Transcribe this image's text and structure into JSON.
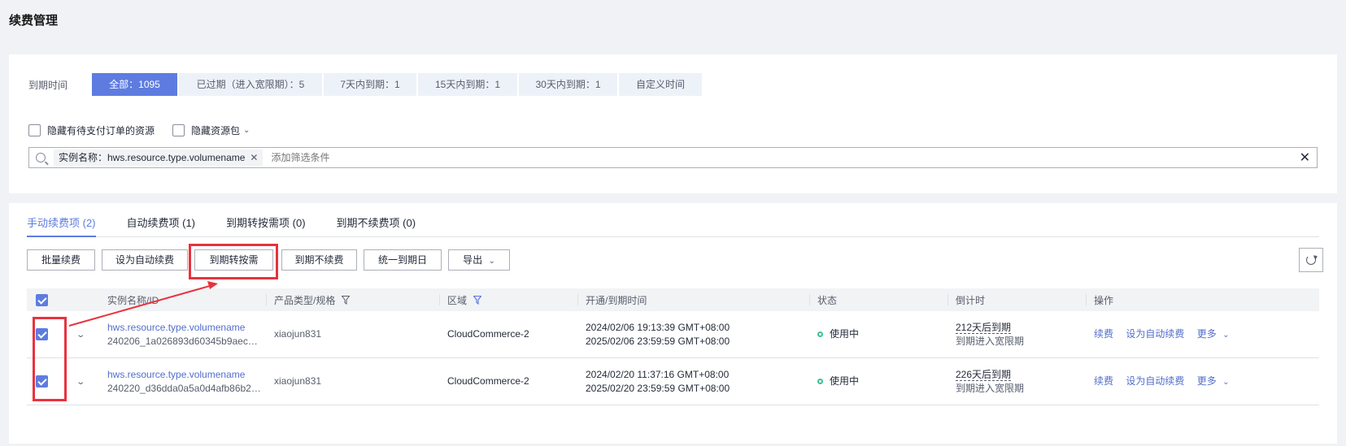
{
  "page_title": "续费管理",
  "filter": {
    "label": "到期时间",
    "chips": [
      {
        "label": "全部：1095",
        "active": true
      },
      {
        "label": "已过期（进入宽限期）：5",
        "active": false
      },
      {
        "label": "7天内到期：1",
        "active": false
      },
      {
        "label": "15天内到期：1",
        "active": false
      },
      {
        "label": "30天内到期：1",
        "active": false
      },
      {
        "label": "自定义时间",
        "active": false
      }
    ]
  },
  "options": {
    "hide_pending": "隐藏有待支付订单的资源",
    "hide_package": "隐藏资源包"
  },
  "search": {
    "tag": "实例名称：hws.resource.type.volumename",
    "placeholder": "添加筛选条件"
  },
  "tabs": [
    {
      "label": "手动续费项 (2)",
      "active": true
    },
    {
      "label": "自动续费项 (1)",
      "active": false
    },
    {
      "label": "到期转按需项 (0)",
      "active": false
    },
    {
      "label": "到期不续费项 (0)",
      "active": false
    }
  ],
  "toolbar": {
    "batch_renew": "批量续费",
    "set_auto": "设为自动续费",
    "to_ondemand": "到期转按需",
    "no_renew": "到期不续费",
    "unify_date": "统一到期日",
    "export": "导出"
  },
  "table": {
    "headers": {
      "name": "实例名称/ID",
      "type": "产品类型/规格",
      "region": "区域",
      "time": "开通/到期时间",
      "status": "状态",
      "countdown": "倒计时",
      "ops": "操作"
    },
    "rows": [
      {
        "name": "hws.resource.type.volumename",
        "id": "240206_1a026893d60345b9aec1b...",
        "type": "xiaojun831",
        "region": "CloudCommerce-2",
        "start": "2024/02/06 19:13:39 GMT+08:00",
        "end": "2025/02/06 23:59:59 GMT+08:00",
        "status": "使用中",
        "countdown": "212天后到期",
        "countdown_sub": "到期进入宽限期",
        "op_renew": "续费",
        "op_auto": "设为自动续费",
        "op_more": "更多"
      },
      {
        "name": "hws.resource.type.volumename",
        "id": "240220_d36dda0a5a0d4afb86b25a...",
        "type": "xiaojun831",
        "region": "CloudCommerce-2",
        "start": "2024/02/20 11:37:16 GMT+08:00",
        "end": "2025/02/20 23:59:59 GMT+08:00",
        "status": "使用中",
        "countdown": "226天后到期",
        "countdown_sub": "到期进入宽限期",
        "op_renew": "续费",
        "op_auto": "设为自动续费",
        "op_more": "更多"
      }
    ]
  },
  "colors": {
    "accent": "#5e7ce0",
    "link": "#526ecc",
    "annotation_red": "#e8323e",
    "status_green": "#3ac295"
  }
}
